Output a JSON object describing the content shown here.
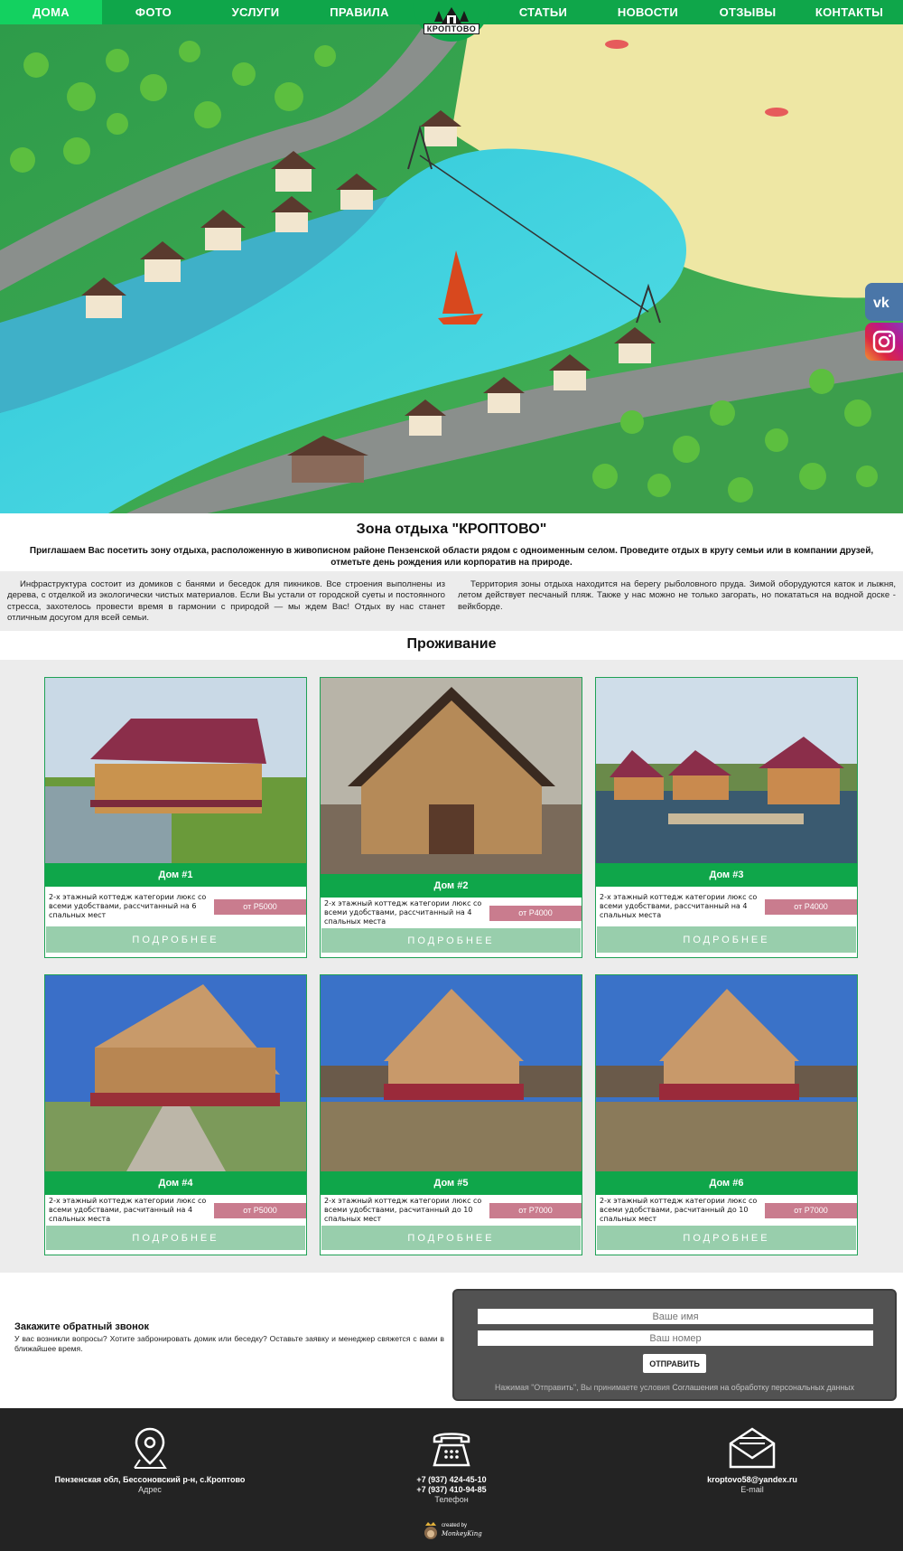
{
  "nav": {
    "items": [
      {
        "label": "ДОМА",
        "active": true
      },
      {
        "label": "ФОТО"
      },
      {
        "label": "УСЛУГИ"
      },
      {
        "label": "ПРАВИЛА"
      },
      {
        "label": "СТАТЬИ"
      },
      {
        "label": "НОВОСТИ"
      },
      {
        "label": "ОТЗЫВЫ"
      },
      {
        "label": "КОНТАКТЫ"
      }
    ],
    "logo_text": "КРОПТОВО"
  },
  "social": {
    "vk_icon": "vk-icon",
    "instagram_icon": "instagram-icon"
  },
  "intro": {
    "title": "Зона отдыха \"КРОПТОВО\"",
    "subtitle": "Приглашаем Вас посетить зону отдыха, расположенную в живописном районе Пензенской области рядом с одноименным селом. Проведите отдых в кругу семьи или в компании друзей, отметьте день рождения или корпоратив на природе."
  },
  "info": {
    "left": "Инфраструктура состоит из домиков с банями и беседок для пикников. Все строения выполнены из дерева, с отделкой из экологически чистых материалов. Если Вы устали от городской суеты и постоянного стресса, захотелось провести время в гармонии с природой — мы ждем Вас! Отдых ву нас станет отличным досугом для всей семьи.",
    "right": "Территория зоны отдыха находится на берегу рыболовного пруда. Зимой оборудуются каток и лыжня, летом действует песчаный пляж. Также у нас можно не только загорать, но покататься на водной доске - вейкборде."
  },
  "houses": {
    "title": "Проживание",
    "more_label": "ПОДРОБНЕЕ",
    "items": [
      {
        "name": "Дом #1",
        "desc": "2-х этажный коттедж категории люкс со всеми удобствами, рассчитанный на 6 спальных мест",
        "price": "от Р5000"
      },
      {
        "name": "Дом #2",
        "desc": "2-х этажный коттедж категории люкс со всеми удобствами, рассчитанный на 4 спальных места",
        "price": "от Р4000"
      },
      {
        "name": "Дом #3",
        "desc": "2-х этажный коттедж категории люкс со всеми удобствами, рассчитанный на 4 спальных места",
        "price": "от Р4000"
      },
      {
        "name": "Дом #4",
        "desc": "2-х этажный коттедж категории люкс со всеми удобствами, расчитанный на 4 спальных места",
        "price": "от Р5000"
      },
      {
        "name": "Дом #5",
        "desc": "2-х этажный коттедж категории люкс со всеми удобствами, расчитанный до 10 спальных мест",
        "price": "от Р7000"
      },
      {
        "name": "Дом #6",
        "desc": "2-х этажный коттедж категории люкс со всеми удобствами, расчитанный до 10 спальных мест",
        "price": "от Р7000"
      }
    ]
  },
  "callback": {
    "title": "Закажите обратный звонок",
    "text": "У вас возникли вопросы? Хотите забронировать домик или беседку? Оставьте заявку и менеджер свяжется с вами в ближайшее время.",
    "name_placeholder": "Ваше имя",
    "phone_placeholder": "Ваш номер",
    "submit": "ОТПРАВИТЬ",
    "note": "Нажимая \"Отправить\", Вы принимаете условия ",
    "note_link": "Соглашения на обработку персональных данных"
  },
  "footer": {
    "address": {
      "value": "Пензенская обл, Бессоновский р-н, с.Кроптово",
      "label": "Адрес"
    },
    "phone": {
      "value1": "+7 (937) 424-45-10",
      "value2": "+7 (937) 410-94-85",
      "label": "Телефон"
    },
    "email": {
      "value": "kroptovo58@yandex.ru",
      "label": "E-mail"
    },
    "created_by": "created by",
    "studio": "MonkeyKing"
  }
}
